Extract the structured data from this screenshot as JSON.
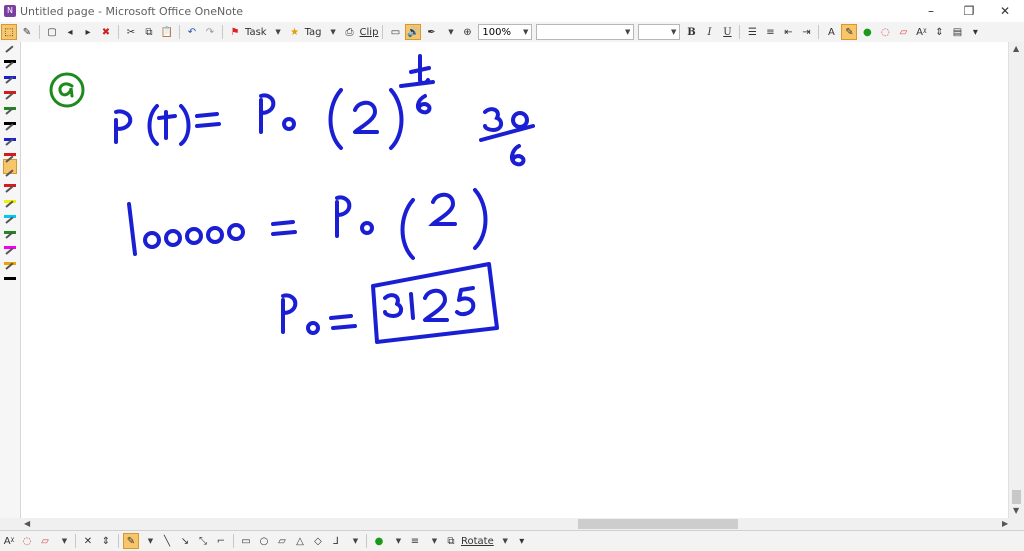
{
  "window": {
    "title": "Untitled page - Microsoft Office OneNote",
    "minimize": "–",
    "restore": "❐",
    "close": "✕"
  },
  "toolbar": {
    "task_label": "Task",
    "tag_label": "Tag",
    "clip_label": "Clip",
    "zoom_value": "100%",
    "font_value": "",
    "size_value": "",
    "bold": "B",
    "italic": "I",
    "underline": "U"
  },
  "drawing_toolbar": {
    "rotate_label": "Rotate"
  },
  "colors": {
    "ink_blue": "#1a1fd4",
    "ink_green": "#1e8a1e",
    "highlight": "#f7c56c"
  },
  "page": {
    "label_a": "a",
    "line1": "P(t) = P₀ (2)^(t/6)",
    "line1_exp": "t/6",
    "line1_exp2": "30/6",
    "line2": "100000 = P₀ (2)",
    "line3": "P₀ = 3125",
    "answer": "3125"
  }
}
